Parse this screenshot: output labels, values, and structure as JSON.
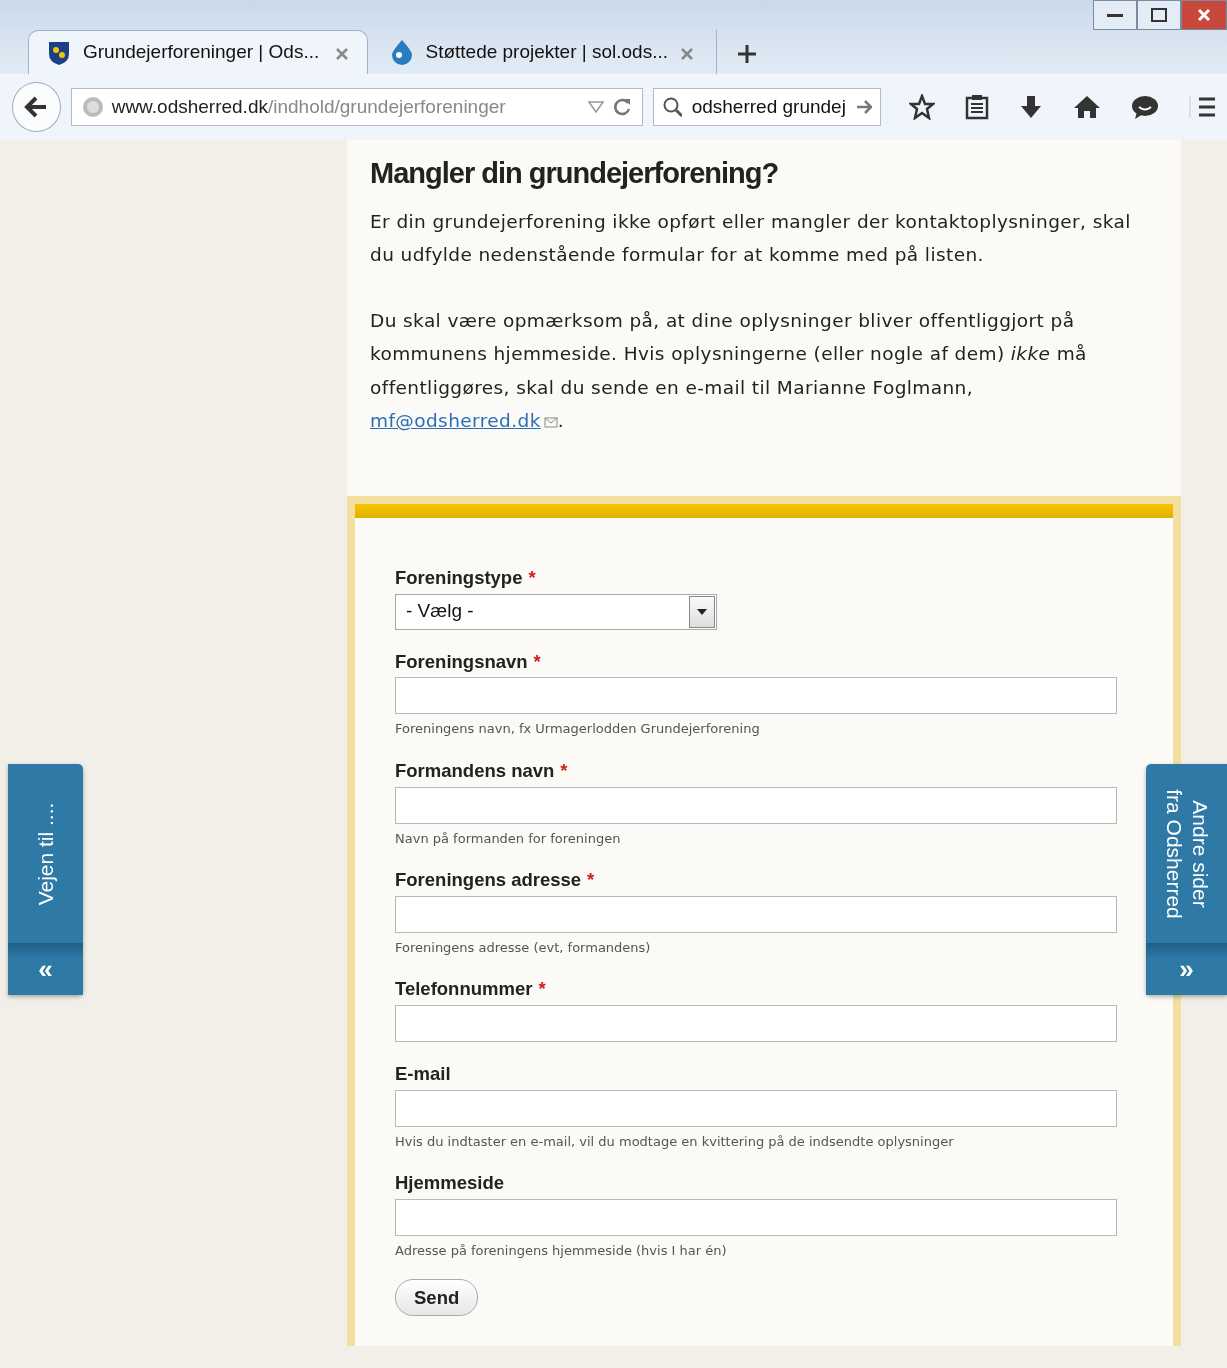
{
  "browser": {
    "tabs": [
      {
        "title": "Grundejerforeninger | Ods...",
        "selected": true
      },
      {
        "title": "Støttede projekter | sol.ods...",
        "selected": false
      }
    ],
    "url": {
      "host": "www.odsherred.dk",
      "path": "/indhold/grundejerforeninger"
    },
    "search": {
      "value": "odsherred grundej"
    }
  },
  "page": {
    "heading": "Mangler din grundejerforening?",
    "paragraphs": [
      {
        "text": "Er din grundejerforening ikke opført eller mangler der kontaktoplysninger, skal du udfylde nedenstående formular for at komme med på listen."
      },
      {
        "text": "Du skal være opmærksom på, at dine oplysninger bliver offentliggjort på kommunens hjemmeside. Hvis oplysningerne (eller nogle af dem) *ikke* må offentliggøres, skal du sende en e-mail til Marianne Foglmann,",
        "link": "mf@odsherred.dk",
        "after": "."
      }
    ]
  },
  "form": {
    "fields": [
      {
        "kind": "select",
        "label": "Foreningstype",
        "required_mark": "*",
        "value": "- Vælg -"
      },
      {
        "kind": "text",
        "label": "Foreningsnavn",
        "required_mark": "*",
        "hint": "Foreningens navn, fx Urmagerlodden Grundejerforening"
      },
      {
        "kind": "text",
        "label": "Formandens navn",
        "required_mark": "*",
        "hint": "Navn på formanden for foreningen"
      },
      {
        "kind": "text",
        "label": "Foreningens adresse",
        "required_mark": "*",
        "hint": "Foreningens adresse (evt, formandens)"
      },
      {
        "kind": "text",
        "label": "Telefonnummer",
        "required_mark": "*"
      },
      {
        "kind": "text",
        "label": "E-mail",
        "hint": "Hvis du indtaster en e-mail, vil du modtage en kvittering på de indsendte oplysninger"
      },
      {
        "kind": "text",
        "label": "Hjemmeside",
        "hint": "Adresse på foreningens hjemmeside (hvis I har én)"
      }
    ],
    "submit": "Send"
  },
  "side_tabs": {
    "left": {
      "label": "Vejen til ....",
      "arrow": "«"
    },
    "right": {
      "lines": [
        "Andre sider",
        "fra Odsherred"
      ],
      "arrow": "»"
    }
  }
}
